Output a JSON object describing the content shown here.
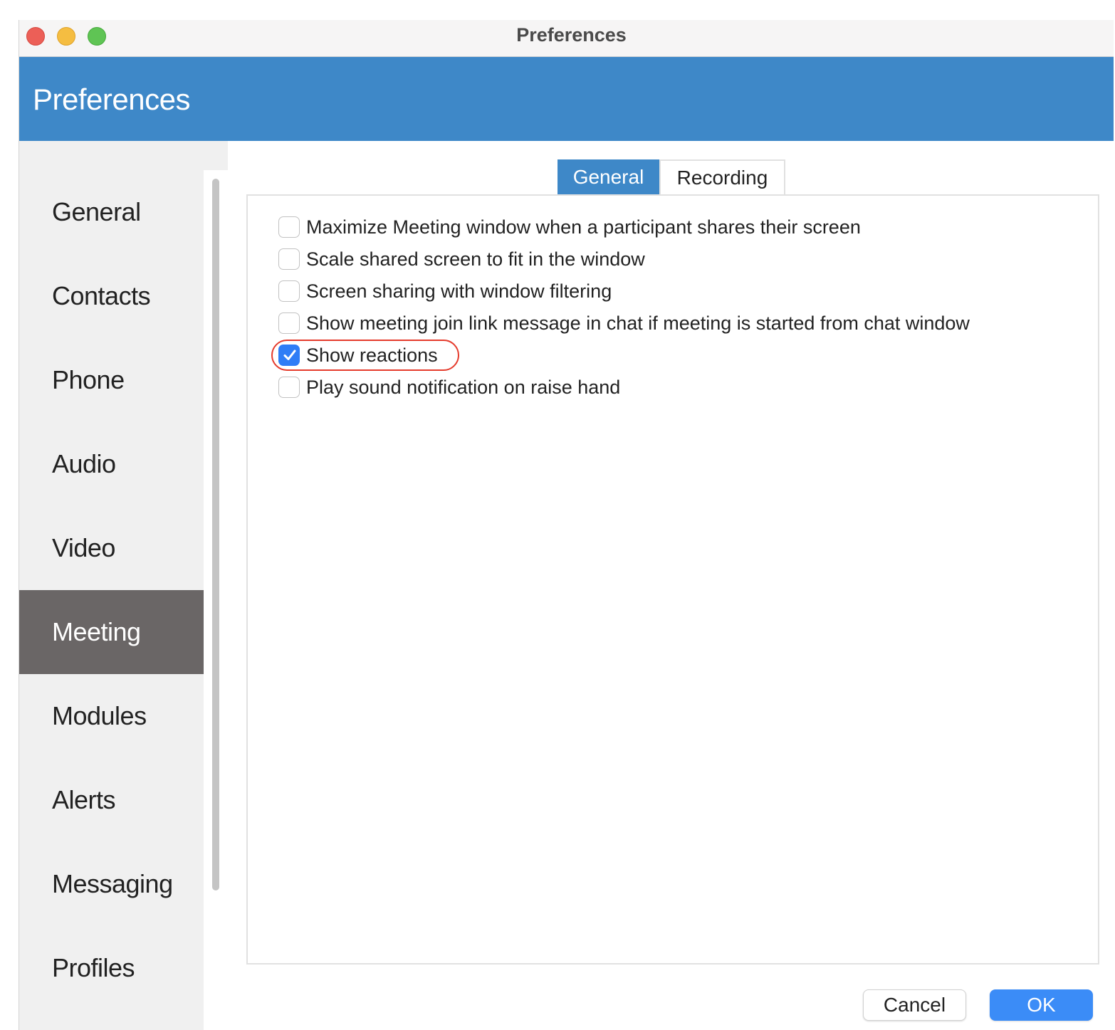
{
  "window": {
    "title": "Preferences",
    "controls": [
      "close",
      "minimize",
      "maximize"
    ]
  },
  "header": {
    "title": "Preferences"
  },
  "sidebar": {
    "items": [
      {
        "label": "General",
        "active": false
      },
      {
        "label": "Contacts",
        "active": false
      },
      {
        "label": "Phone",
        "active": false
      },
      {
        "label": "Audio",
        "active": false
      },
      {
        "label": "Video",
        "active": false
      },
      {
        "label": "Meeting",
        "active": true
      },
      {
        "label": "Modules",
        "active": false
      },
      {
        "label": "Alerts",
        "active": false
      },
      {
        "label": "Messaging",
        "active": false
      },
      {
        "label": "Profiles",
        "active": false
      }
    ]
  },
  "tabs": [
    {
      "label": "General",
      "active": true
    },
    {
      "label": "Recording",
      "active": false
    }
  ],
  "options": [
    {
      "label": "Maximize Meeting window when a participant shares their screen",
      "checked": false
    },
    {
      "label": "Scale shared screen to fit in the window",
      "checked": false
    },
    {
      "label": "Screen sharing with window filtering",
      "checked": false
    },
    {
      "label": "Show meeting join link message in chat if meeting is started from chat window",
      "checked": false
    },
    {
      "label": "Show reactions",
      "checked": true,
      "highlighted": true
    },
    {
      "label": "Play sound notification on raise hand",
      "checked": false
    }
  ],
  "buttons": {
    "cancel_label": "Cancel",
    "ok_label": "OK"
  },
  "colors": {
    "accent": "#3e88c8",
    "sidebar_active": "#6a6666",
    "checkbox_checked": "#2f7df6",
    "highlight_ring": "#e53b2c",
    "ok_button": "#3b8cf7"
  }
}
